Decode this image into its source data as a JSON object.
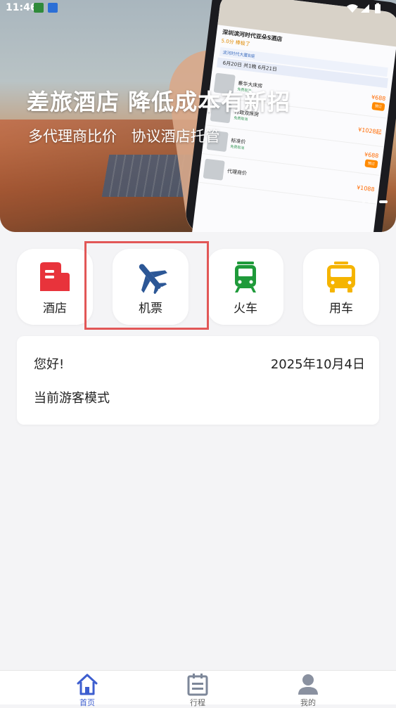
{
  "status_bar": {
    "time": "11:46"
  },
  "banner": {
    "headline": "差旅酒店 降低成本有新招",
    "subline": "多代理商比价 协议酒店托管",
    "phone": {
      "hotel_name": "深圳滨河时代亚朵S酒店",
      "score": "5.0分 棒极了",
      "location": "滨河时代大厦B座",
      "dates": "6月20日 共1晚 6月21日",
      "agent_label": "代理商价",
      "rooms": [
        {
          "name": "豪华大床房",
          "note": "免费取消",
          "price": "¥688"
        },
        {
          "name": "行政双床房",
          "note": "免费取消",
          "price": "¥1028起"
        },
        {
          "name": "标准价",
          "note": "免费取消",
          "price": "¥688"
        },
        {
          "name": "",
          "note": "",
          "price": "¥1088"
        }
      ],
      "book_label": "预订"
    }
  },
  "services": [
    {
      "label": "酒店",
      "icon": "hotel-icon",
      "color": "#e8333b"
    },
    {
      "label": "机票",
      "icon": "airplane-icon",
      "color": "#2c5796"
    },
    {
      "label": "火车",
      "icon": "train-icon",
      "color": "#1f9a3a"
    },
    {
      "label": "用车",
      "icon": "bus-icon",
      "color": "#f5b400"
    }
  ],
  "greeting": {
    "hello": "您好!",
    "date": "2025年10月4日",
    "mode": "当前游客模式"
  },
  "nav": {
    "items": [
      {
        "label": "首页",
        "icon": "home-icon",
        "active": true
      },
      {
        "label": "行程",
        "icon": "calendar-icon",
        "active": false
      },
      {
        "label": "我的",
        "icon": "profile-icon",
        "active": false
      }
    ]
  },
  "colors": {
    "accent": "#3d5ecf",
    "highlight_border": "#e25757",
    "background": "#f4f4f6"
  }
}
